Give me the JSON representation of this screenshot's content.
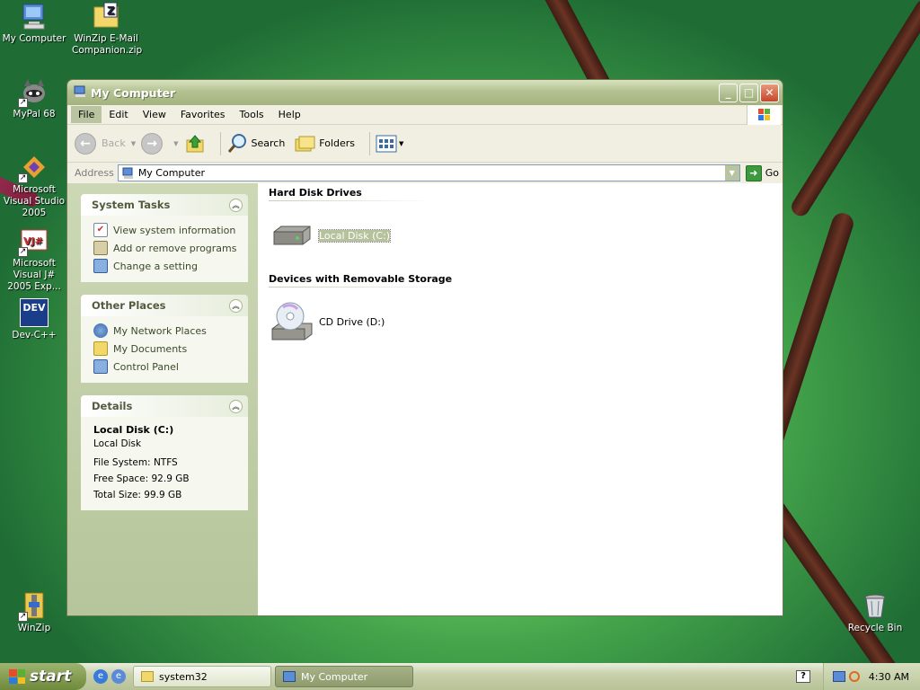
{
  "desktop": {
    "icons": [
      {
        "label": "My Computer"
      },
      {
        "label": "WinZip E-Mail Companion.zip"
      },
      {
        "label": "MyPal 68"
      },
      {
        "label": "Microsoft Visual Studio 2005"
      },
      {
        "label": "Microsoft Visual J# 2005 Exp..."
      },
      {
        "label": "Dev-C++"
      },
      {
        "label": "WinZip"
      },
      {
        "label": "Recycle Bin"
      }
    ],
    "dev_icon_text": "DEV",
    "vj_icon_text": "VJ#"
  },
  "window": {
    "title": "My Computer",
    "menu": [
      "File",
      "Edit",
      "View",
      "Favorites",
      "Tools",
      "Help"
    ],
    "toolbar": {
      "back": "Back",
      "search": "Search",
      "folders": "Folders"
    },
    "address": {
      "label": "Address",
      "value": "My Computer",
      "go": "Go"
    },
    "system_tasks": {
      "title": "System Tasks",
      "items": [
        "View system information",
        "Add or remove programs",
        "Change a setting"
      ]
    },
    "other_places": {
      "title": "Other Places",
      "items": [
        "My Network Places",
        "My Documents",
        "Control Panel"
      ]
    },
    "details": {
      "title": "Details",
      "name": "Local Disk (C:)",
      "type": "Local Disk",
      "file_system": "File System: NTFS",
      "free_space": "Free Space: 92.9 GB",
      "total_size": "Total Size: 99.9 GB"
    },
    "sections": [
      {
        "title": "Hard Disk Drives",
        "items": [
          "Local Disk (C:)"
        ]
      },
      {
        "title": "Devices with Removable Storage",
        "items": [
          "CD Drive (D:)"
        ]
      }
    ]
  },
  "taskbar": {
    "start": "start",
    "tasks": [
      "system32",
      "My Computer"
    ],
    "clock": "4:30 AM"
  },
  "colors": {
    "accent": "#b3c291",
    "panel_text": "#535a40"
  }
}
